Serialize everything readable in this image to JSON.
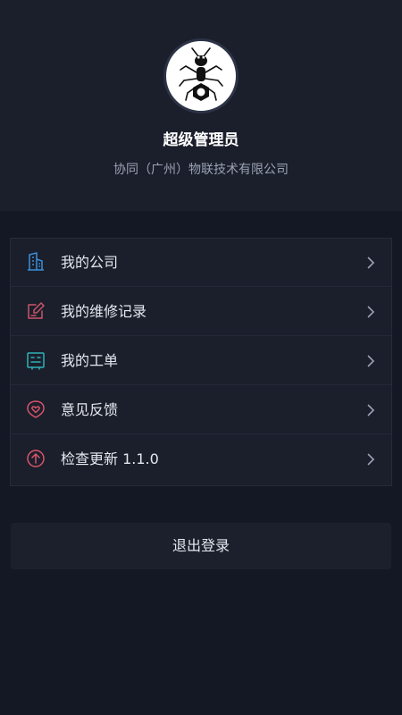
{
  "profile": {
    "avatar_icon": "ant-robot-logo-icon",
    "name": "超级管理员",
    "company": "协同（广州）物联技术有限公司"
  },
  "menu": {
    "items": [
      {
        "label": "我的公司",
        "icon": "building-icon",
        "color": "#3a8fd8"
      },
      {
        "label": "我的维修记录",
        "icon": "edit-note-icon",
        "color": "#c9556a"
      },
      {
        "label": "我的工单",
        "icon": "work-order-icon",
        "color": "#2fb0b8"
      },
      {
        "label": "意见反馈",
        "icon": "feedback-heart-icon",
        "color": "#d9546a"
      },
      {
        "label": "检查更新 1.1.0",
        "icon": "upload-circle-icon",
        "color": "#d9546a"
      }
    ]
  },
  "logout": {
    "label": "退出登录"
  },
  "colors": {
    "background": "#141824",
    "header": "#1b1f2c",
    "panel": "#1a1f2b",
    "text": "#e4e7ee",
    "muted": "#9aa1b2"
  }
}
